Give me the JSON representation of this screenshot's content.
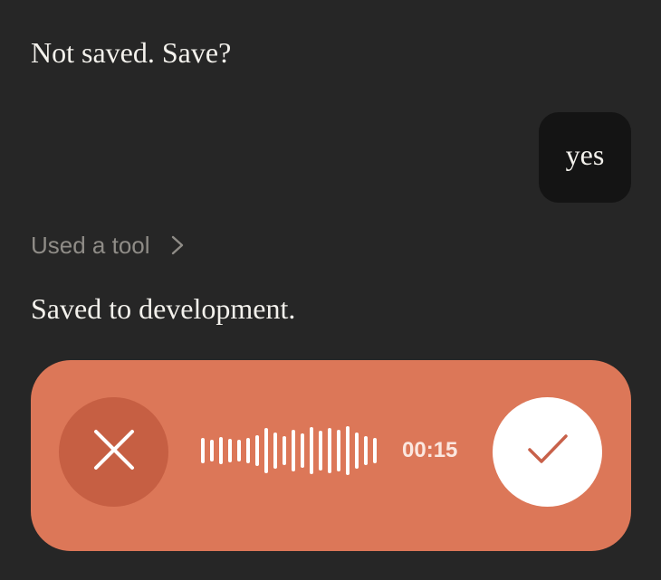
{
  "conversation": {
    "assistant_message_1": "Not saved. Save?",
    "user_message": "yes",
    "tool_toggle_label": "Used a tool",
    "assistant_message_2": "Saved to development."
  },
  "voice_recorder": {
    "timer": "00:15",
    "icons": {
      "cancel": "close-icon",
      "confirm": "checkmark-icon",
      "waveform": "audio-waveform"
    }
  },
  "colors": {
    "background": "#262626",
    "user_bubble": "#141414",
    "muted_text": "#8f8c87",
    "recorder_bar": "#dc7758",
    "cancel_button": "#c65f43",
    "confirm_button": "#ffffff",
    "checkmark": "#c8614a"
  }
}
